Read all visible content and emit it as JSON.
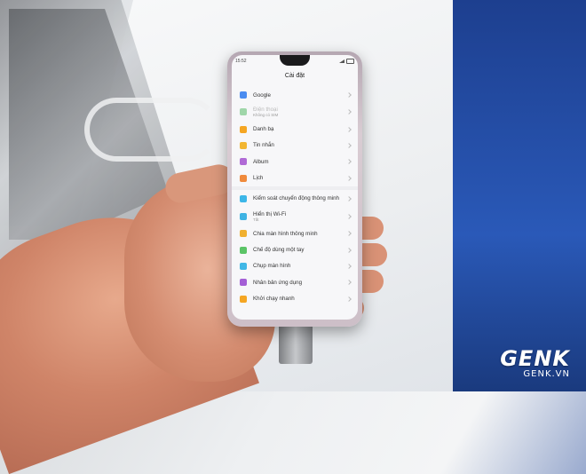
{
  "phone": {
    "status_time": "15:52",
    "screen_title": "Cài đặt",
    "items": [
      {
        "label": "Google",
        "sub": "",
        "icon": "google-icon",
        "color": "#4a8cf0",
        "dim": false
      },
      {
        "label": "Điện thoại",
        "sub": "Không có SIM",
        "icon": "phone-icon",
        "color": "#9fd6a9",
        "dim": true
      },
      {
        "label": "Danh bạ",
        "sub": "",
        "icon": "contacts-icon",
        "color": "#f5a623",
        "dim": false
      },
      {
        "label": "Tin nhắn",
        "sub": "",
        "icon": "messages-icon",
        "color": "#f2b632",
        "dim": false
      },
      {
        "label": "Album",
        "sub": "",
        "icon": "album-icon",
        "color": "#b06ad6",
        "dim": false
      },
      {
        "label": "Lịch",
        "sub": "",
        "icon": "calendar-icon",
        "color": "#f08a3c",
        "dim": false
      },
      {
        "label": "Kiểm soát chuyển động thông minh",
        "sub": "",
        "icon": "motion-icon",
        "color": "#3cb6e8",
        "dim": false
      },
      {
        "label": "Hiển thị Wi-Fi",
        "sub": "Tắt",
        "icon": "wifi-display-icon",
        "color": "#3fb3e3",
        "dim": false
      },
      {
        "label": "Chia màn hình thông minh",
        "sub": "",
        "icon": "split-screen-icon",
        "color": "#f0b030",
        "dim": false
      },
      {
        "label": "Chế độ dùng một tay",
        "sub": "",
        "icon": "one-hand-icon",
        "color": "#5bc467",
        "dim": false
      },
      {
        "label": "Chụp màn hình",
        "sub": "",
        "icon": "screenshot-icon",
        "color": "#40b7e6",
        "dim": false
      },
      {
        "label": "Nhân bản ứng dụng",
        "sub": "",
        "icon": "app-clone-icon",
        "color": "#a45fd6",
        "dim": false
      },
      {
        "label": "Khởi chạy nhanh",
        "sub": "",
        "icon": "quick-launch-icon",
        "color": "#f5a623",
        "dim": false
      }
    ]
  },
  "watermark": {
    "logo": "GENK",
    "site": "GENK.VN"
  }
}
